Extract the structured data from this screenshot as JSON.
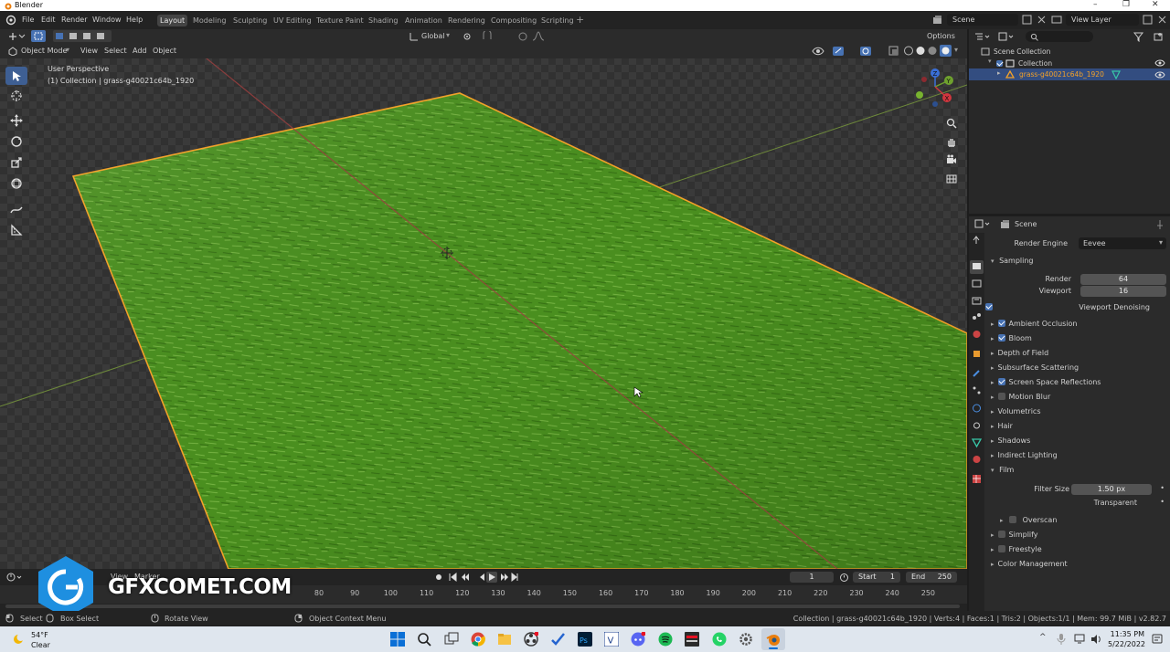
{
  "titlebar": {
    "app_title": "Blender"
  },
  "menu": {
    "items": [
      "File",
      "Edit",
      "Render",
      "Window",
      "Help"
    ]
  },
  "workspaces": {
    "tabs": [
      "Layout",
      "Modeling",
      "Sculpting",
      "UV Editing",
      "Texture Paint",
      "Shading",
      "Animation",
      "Rendering",
      "Compositing",
      "Scripting"
    ],
    "active": "Layout"
  },
  "topright": {
    "scene": "Scene",
    "view_layer": "View Layer"
  },
  "toolheader": {
    "transform_orientation": "Global",
    "options": "Options"
  },
  "viewport": {
    "mode": "Object Mode",
    "menus": [
      "View",
      "Select",
      "Add",
      "Object"
    ],
    "overlay_title": "User Perspective",
    "overlay_subtitle": "(1) Collection | grass-g40021c64b_1920",
    "gizmo_labels": {
      "z": "Z",
      "y": "Y",
      "x": "X"
    }
  },
  "outliner": {
    "root": "Scene Collection",
    "collection": "Collection",
    "object": "grass-g40021c64b_1920"
  },
  "properties": {
    "context": "Scene",
    "render_engine_label": "Render Engine",
    "render_engine": "Eevee",
    "sampling": {
      "label": "Sampling",
      "render_label": "Render",
      "render": "64",
      "viewport_label": "Viewport",
      "viewport": "16",
      "denoise_label": "Viewport Denoising"
    },
    "panels": [
      {
        "label": "Ambient Occlusion",
        "check": "on"
      },
      {
        "label": "Bloom",
        "check": "on"
      },
      {
        "label": "Depth of Field",
        "check": "none"
      },
      {
        "label": "Subsurface Scattering",
        "check": "none"
      },
      {
        "label": "Screen Space Reflections",
        "check": "on"
      },
      {
        "label": "Motion Blur",
        "check": "off"
      },
      {
        "label": "Volumetrics",
        "check": "none"
      },
      {
        "label": "Hair",
        "check": "none"
      },
      {
        "label": "Shadows",
        "check": "none"
      },
      {
        "label": "Indirect Lighting",
        "check": "none"
      }
    ],
    "film": {
      "label": "Film",
      "filter_label": "Filter Size",
      "filter": "1.50 px",
      "transparent_label": "Transparent",
      "overscan": "Overscan"
    },
    "bottom_panels": [
      {
        "label": "Simplify",
        "check": "off"
      },
      {
        "label": "Freestyle",
        "check": "off"
      },
      {
        "label": "Color Management",
        "check": "none"
      }
    ]
  },
  "timeline": {
    "menus": [
      "View",
      "Marker"
    ],
    "current_frame": "1",
    "start_label": "Start",
    "start": "1",
    "end_label": "End",
    "end": "250",
    "ticks": [
      "80",
      "90",
      "100",
      "110",
      "120",
      "130",
      "140",
      "150",
      "160",
      "170",
      "180",
      "190",
      "200",
      "210",
      "220",
      "230",
      "240",
      "250"
    ]
  },
  "watermark": {
    "text": "GFXCOMET.COM"
  },
  "statusbar": {
    "select": "Select",
    "box_select": "Box Select",
    "rotate_view": "Rotate View",
    "context_menu": "Object Context Menu",
    "info": "Collection | grass-g40021c64b_1920 | Verts:4 | Faces:1 | Tris:2 | Objects:1/1 | Mem: 99.7 MiB | v2.82.7"
  },
  "taskbar": {
    "weather_temp": "54°F",
    "weather_text": "Clear",
    "time": "11:35 PM",
    "date": "5/22/2022"
  },
  "colors": {
    "accent": "#4772b3",
    "selection_orange": "#f4a228",
    "grass_dark": "#3f7f19",
    "grass_light": "#7ac142"
  }
}
